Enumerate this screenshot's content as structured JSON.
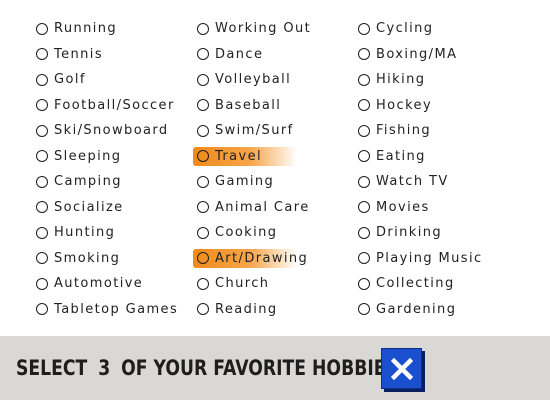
{
  "hobbies": {
    "columns": [
      [
        "Running",
        "Tennis",
        "Golf",
        "Football/Soccer",
        "Ski/Snowboard",
        "Sleeping",
        "Camping",
        "Socialize",
        "Hunting",
        "Smoking",
        "Automotive",
        "Tabletop Games"
      ],
      [
        "Working Out",
        "Dance",
        "Volleyball",
        "Baseball",
        "Swim/Surf",
        "Travel",
        "Gaming",
        "Animal Care",
        "Cooking",
        "Art/Drawing",
        "Church",
        "Reading"
      ],
      [
        "Cycling",
        "Boxing/MA",
        "Hiking",
        "Hockey",
        "Fishing",
        "Eating",
        "Watch TV",
        "Movies",
        "Drinking",
        "Playing Music",
        "Collecting",
        "Gardening"
      ]
    ],
    "selected": [
      "Travel",
      "Art/Drawing"
    ]
  },
  "footer": {
    "prefix": "SELECT",
    "count": "3",
    "suffix": "OF YOUR FAVORITE HOBBIES"
  },
  "close_button": {
    "icon": "close-icon",
    "color": "#1a4fcf"
  },
  "colors": {
    "selected_highlight": "#f08a1a",
    "footer_bg": "#d9d8d4"
  }
}
